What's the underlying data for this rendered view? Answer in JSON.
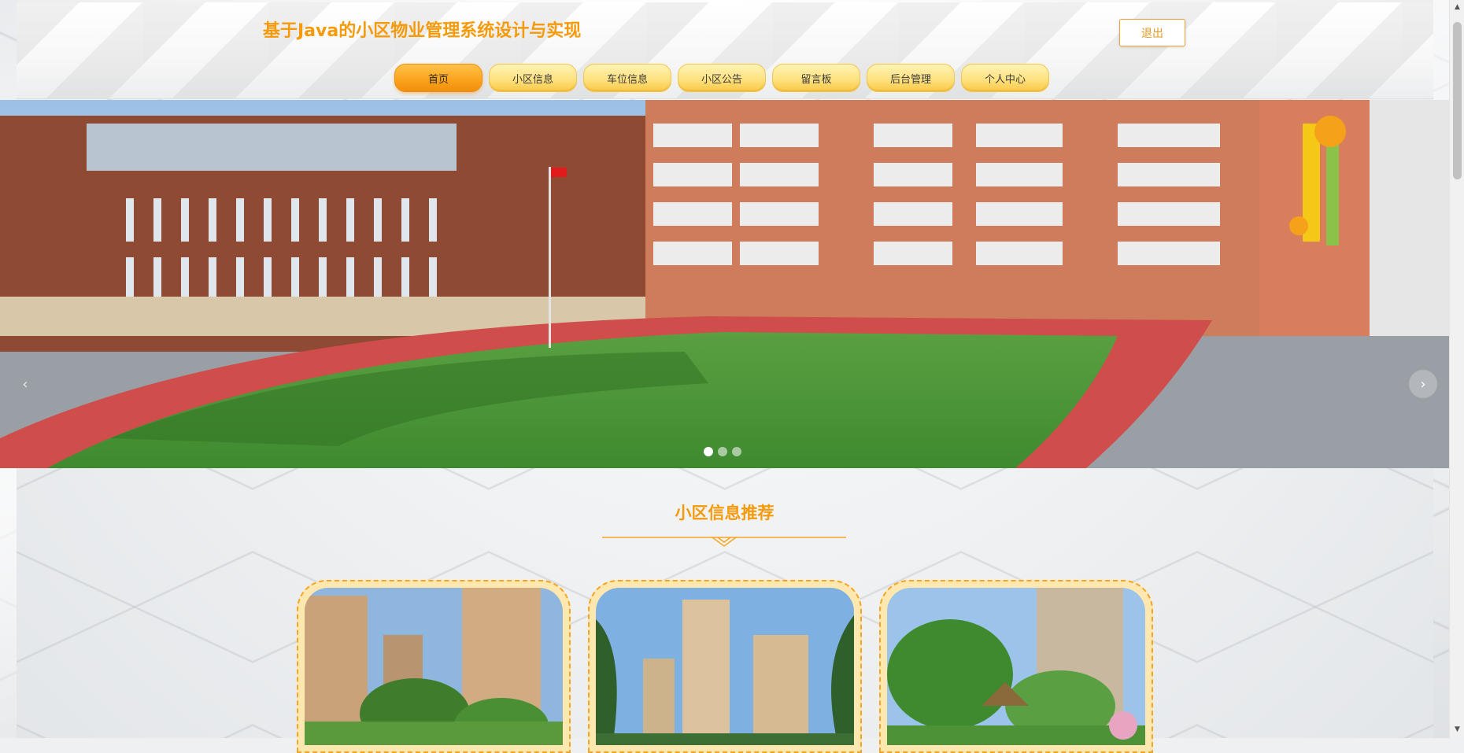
{
  "header": {
    "title": "基于Java的小区物业管理系统设计与实现",
    "logout_label": "退出"
  },
  "nav": {
    "items": [
      {
        "label": "首页",
        "active": true
      },
      {
        "label": "小区信息"
      },
      {
        "label": "车位信息"
      },
      {
        "label": "小区公告"
      },
      {
        "label": "留言板"
      },
      {
        "label": "后台管理"
      },
      {
        "label": "个人中心"
      }
    ]
  },
  "banner": {
    "slide_count": 3,
    "active_slide": 1,
    "prev_icon": "chevron-left-icon",
    "next_icon": "chevron-right-icon"
  },
  "section": {
    "title": "小区信息推荐"
  },
  "colors": {
    "accent": "#f59a0a",
    "nav_bg": "#ffe281",
    "nav_active": "#fba21b"
  }
}
